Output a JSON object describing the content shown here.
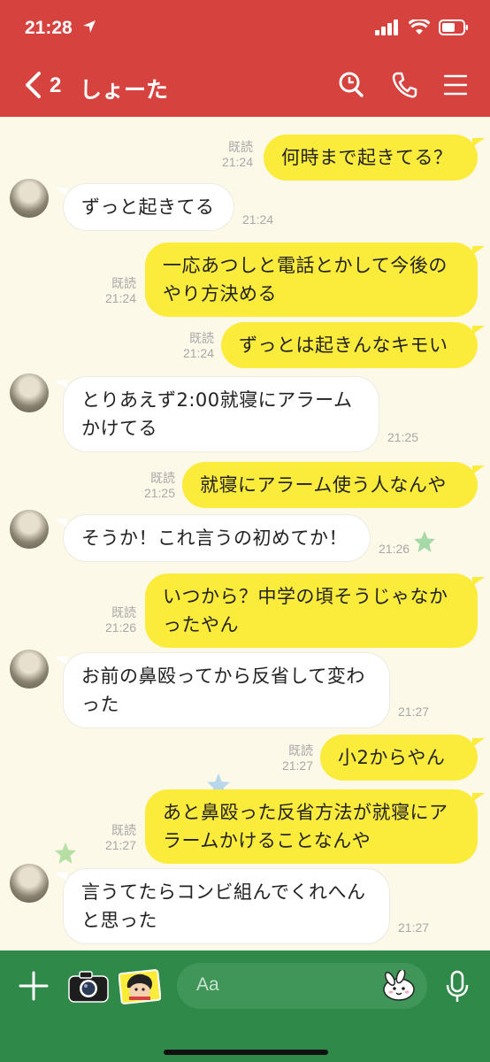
{
  "status": {
    "time": "21:28"
  },
  "header": {
    "back_count": "2",
    "title": "しょーた"
  },
  "messages": [
    {
      "from": "me",
      "text": "何時まで起きてる？",
      "read": "既読",
      "time": "21:24"
    },
    {
      "from": "them",
      "text": "ずっと起きてる",
      "time": "21:24"
    },
    {
      "from": "me",
      "lines": [
        "一応あつしと電話とかして今後の",
        "やり方決める"
      ],
      "read": "既読",
      "time": "21:24"
    },
    {
      "from": "me",
      "text": "ずっとは起きんなキモい",
      "read": "既読",
      "time": "21:24"
    },
    {
      "from": "them",
      "lines": [
        "とりあえず2:00就寝にアラーム",
        "かけてる"
      ],
      "time": "21:25"
    },
    {
      "from": "me",
      "text": "就寝にアラーム使う人なんや",
      "read": "既読",
      "time": "21:25"
    },
    {
      "from": "them",
      "text": "そうか！これ言うの初めてか！",
      "time": "21:26"
    },
    {
      "from": "me",
      "lines": [
        "いつから？中学の頃そうじゃなか",
        "ったやん"
      ],
      "read": "既読",
      "time": "21:26"
    },
    {
      "from": "them",
      "lines": [
        "お前の鼻殴ってから反省して変わ",
        "った"
      ],
      "time": "21:27"
    },
    {
      "from": "me",
      "text": "小2からやん",
      "read": "既読",
      "time": "21:27"
    },
    {
      "from": "me",
      "lines": [
        "あと鼻殴った反省方法が就寝にア",
        "ラームかけることなんや"
      ],
      "read": "既読",
      "time": "21:27"
    },
    {
      "from": "them",
      "lines": [
        "言うてたらコンビ組んでくれへん",
        "と思った"
      ],
      "time": "21:27"
    }
  ],
  "composer": {
    "placeholder": "Aa"
  },
  "colors": {
    "header": "#d6423d",
    "chat_bg": "#fcf9e8",
    "my_bubble": "#fbeb3b",
    "their_bubble": "#ffffff",
    "bottom_bar": "#2f8a49"
  },
  "icons": [
    "location-arrow-icon",
    "signal-icon",
    "wifi-icon",
    "battery-icon",
    "back-chevron-icon",
    "search-icon",
    "phone-icon",
    "menu-icon",
    "plus-icon",
    "camera-icon",
    "sticker-icon",
    "emoji-icon",
    "microphone-icon"
  ]
}
